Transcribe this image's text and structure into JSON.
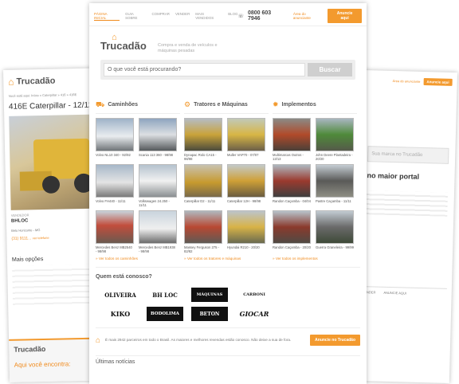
{
  "left_page": {
    "brand": "Trucadão",
    "breadcrumb": "Você está aqui: Início » Caterpillar » 416 » 416E",
    "title": "416E Caterpillar - 12/12",
    "seller_label": "VENDEDOR",
    "seller_name": "BHLOC",
    "location": "Belo Horizonte - MG",
    "phone": "(31) 9111...",
    "phone_link": "ver telefone",
    "more_options": "Mais opções",
    "footer_brand": "Trucadão",
    "footer_find": "Aqui você encontra:"
  },
  "right_page": {
    "header_link": "Área do anunciante",
    "header_button": "Anuncie aqui",
    "search_placeholder": "Sua marca no Trucadão",
    "headline": "no maior portal",
    "footer_col1": "VENDER",
    "footer_col2": "ANUNCIE AQUI"
  },
  "main": {
    "nav": [
      "PÁGINA INICIAL",
      "GUIA SOBRE",
      "COMPRAR",
      "VENDER",
      "MAIS VENDIDOS",
      "BLOG"
    ],
    "phone": "0800 603 7946",
    "area_link": "Área do anunciante",
    "anuncie_button": "Anuncie aqui",
    "brand": "Trucadão",
    "tagline": "Compra e venda de veículos e máquinas pesadas",
    "search_placeholder": "O que você está procurando?",
    "search_button": "Buscar",
    "categories": [
      {
        "title": "Caminhões",
        "icon": "truck-icon",
        "link": "Ver todos os caminhões",
        "items": [
          "Volvo NL10 340 - 92/92",
          "Scania 113 360 - 98/98",
          "Mercedes Benz MB2540 - 98/98",
          "Mercedes Benz MB1938 - 98/98"
        ],
        "items2": [
          "Volvo FH440 - 11/11",
          "Volkswagen 24.250 - 11/11"
        ]
      },
      {
        "title": "Tratores e Máquinas",
        "icon": "tractor-icon",
        "link": "Ver todos os tratores e máquinas",
        "items": [
          "Dynapac Rolo CA15 - 98/98",
          "Muller VAP70 - 07/07",
          "Massey Ferguson 275 - 82/82",
          "Hyundai R210 - 20/20"
        ],
        "items2": [
          "Caterpillar D2 - 11/11",
          "Caterpillar 12H - 98/98"
        ]
      },
      {
        "title": "Implementos",
        "icon": "gear-icon",
        "link": "Ver todos os implementos",
        "items": [
          "Multimarcas Outros - 13/13",
          "John Deere Plantadeira - 20/20",
          "Randon Caçamba - 20/20",
          "Guerra Graneleira - 99/99"
        ],
        "items2": [
          "Randon Caçamba - 04/04",
          "Pastre Caçamba - 11/11"
        ]
      }
    ],
    "partners_title": "Quem está conosco?",
    "partners": [
      "OLIVEIRA",
      "BH LOC",
      "MÁQUINAS",
      "CARBONI",
      "KIKO",
      "BODOLIMA",
      "BETON",
      "GIOCAR"
    ],
    "promo_text": "É mais 2942 parceiros em todo o Brasil. As maiores e melhores revendas estão conosco. Não deixe a sua de fora.",
    "promo_button": "Anuncie no Trucadão",
    "news_title": "Últimas notícias"
  },
  "colors": {
    "accent": "#f39a2e",
    "text": "#444444",
    "brand": "#1f4e96"
  }
}
